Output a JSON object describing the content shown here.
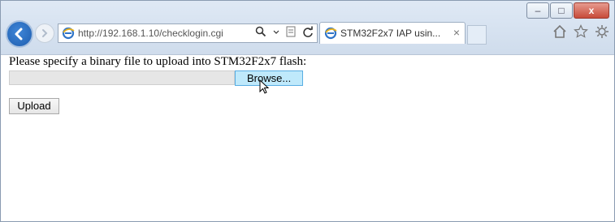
{
  "browser": {
    "address_url": "http://192.168.1.10/checklogin.cgi",
    "tab_title": "STM32F2x7 IAP usin...",
    "tab_close": "×",
    "caption_minimize": "–",
    "caption_maximize": "□",
    "caption_close": "x"
  },
  "page": {
    "prompt": "Please specify a binary file to upload into STM32F2x7 flash:",
    "file_path_value": "",
    "browse_label": "Browse...",
    "upload_label": "Upload"
  },
  "icons": {
    "back": "back-arrow-icon",
    "forward": "forward-arrow-icon",
    "ie": "internet-explorer-icon",
    "search": "search-icon",
    "dropdown": "chevron-down-icon",
    "compatibility": "compatibility-view-icon",
    "refresh": "refresh-icon",
    "home": "home-icon",
    "favorites": "star-icon",
    "settings": "gear-icon",
    "cursor": "mouse-cursor-icon"
  },
  "colors": {
    "browse_bg": "#bfe9fb",
    "browse_border": "#59aee3",
    "titlebar": "#dfe9f5",
    "close_button": "#c74b3a"
  }
}
